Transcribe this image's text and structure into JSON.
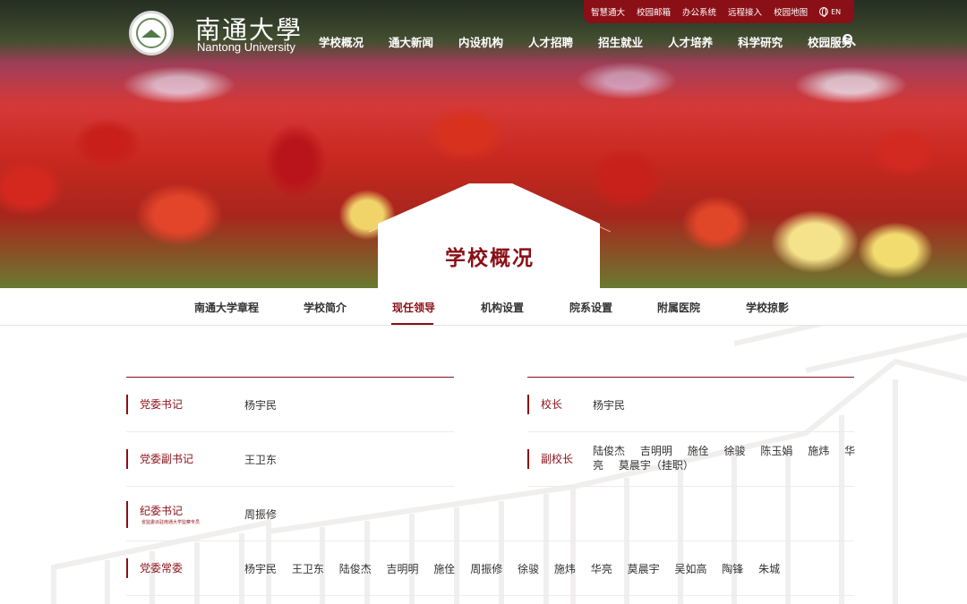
{
  "header": {
    "brand_cn": "南通大學",
    "brand_en": "Nantong University",
    "logo_text": "1912",
    "util_links": [
      "智慧通大",
      "校园邮箱",
      "办公系统",
      "远程接入",
      "校园地图"
    ],
    "lang": "EN",
    "nav": [
      "学校概况",
      "通大新闻",
      "内设机构",
      "人才招聘",
      "招生就业",
      "人才培养",
      "科学研究",
      "校园服务"
    ]
  },
  "hero": {
    "page_title": "学校概况"
  },
  "subnav": {
    "items": [
      "南通大学章程",
      "学校简介",
      "现任领导",
      "机构设置",
      "院系设置",
      "附属医院",
      "学校掠影"
    ],
    "active": "现任领导"
  },
  "leaders": {
    "left": [
      {
        "role": "党委书记",
        "names": [
          "杨宇民"
        ]
      },
      {
        "role": "党委副书记",
        "names": [
          "王卫东"
        ]
      },
      {
        "role": "纪委书记",
        "sub": "省监委派驻南通大学监察专员",
        "names": [
          "周振修"
        ]
      }
    ],
    "right": [
      {
        "role": "校长",
        "names": [
          "杨宇民"
        ]
      },
      {
        "role": "副校长",
        "names": [
          "陆俊杰",
          "吉明明",
          "施佺",
          "徐骏",
          "陈玉娟",
          "施炜",
          "华亮",
          "莫晨宇（挂职）"
        ]
      }
    ],
    "standing": {
      "role": "党委常委",
      "names": [
        "杨宇民",
        "王卫东",
        "陆俊杰",
        "吉明明",
        "施佺",
        "周振修",
        "徐骏",
        "施炜",
        "华亮",
        "莫晨宇",
        "吴如高",
        "陶锋",
        "朱城"
      ]
    }
  },
  "colors": {
    "accent": "#8a0f16",
    "rule": "#ececec",
    "text": "#333333"
  }
}
